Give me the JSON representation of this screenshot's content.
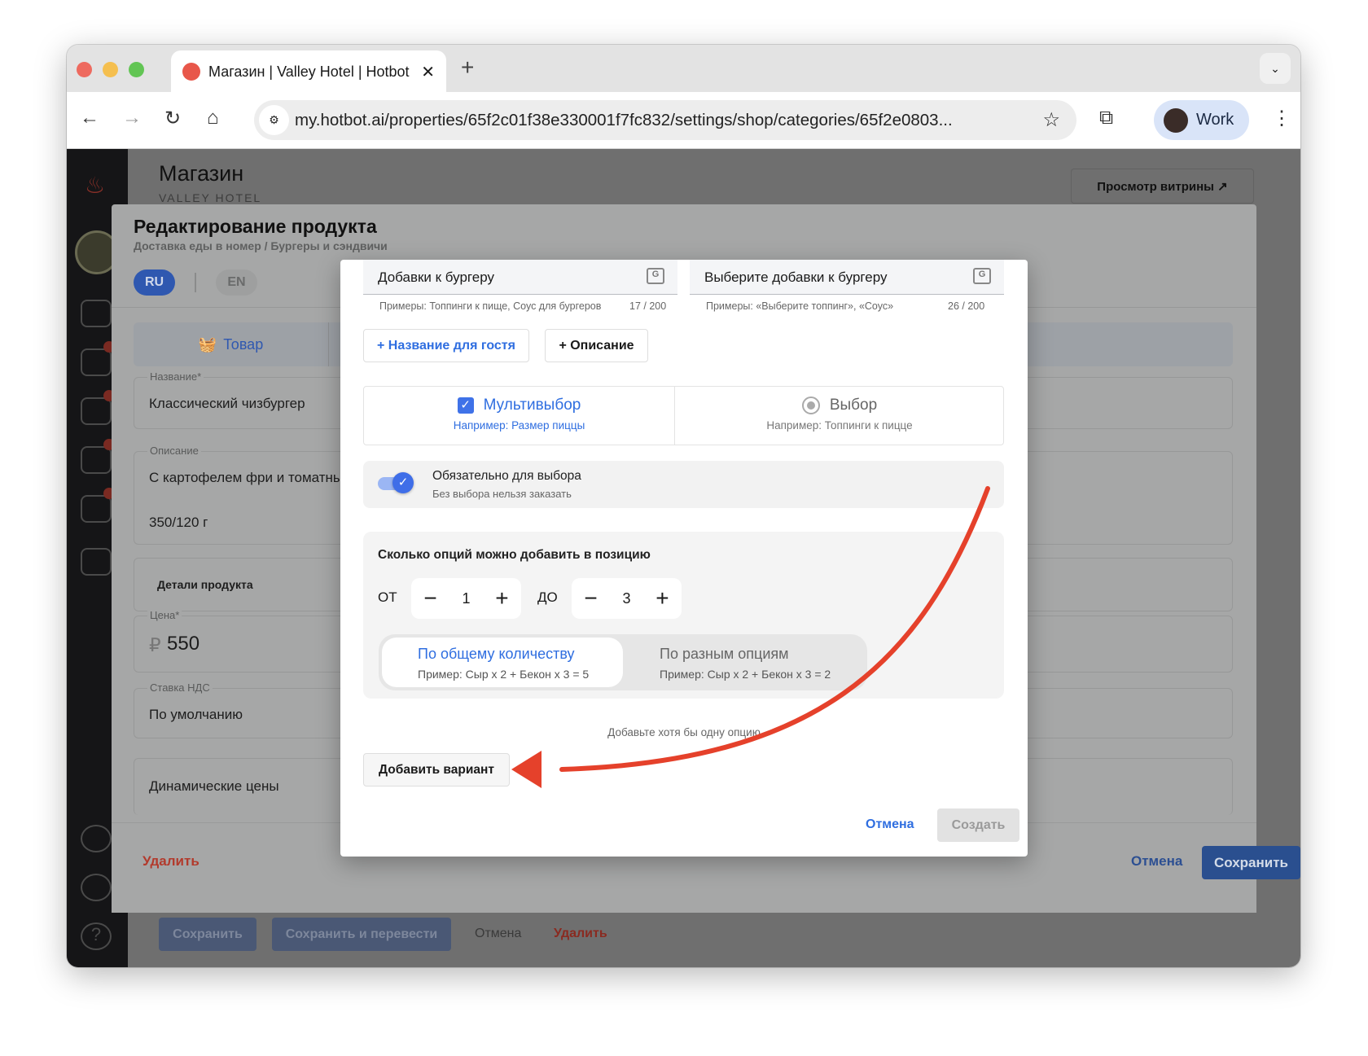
{
  "browser": {
    "tab_title": "Магазин | Valley Hotel | Hotbot",
    "url": "my.hotbot.ai/properties/65f2c01f38e330001f7fc832/settings/shop/categories/65f2e0803...",
    "profile": "Work"
  },
  "page": {
    "title": "Магазин",
    "subtitle": "VALLEY HOTEL",
    "storefront_button": "Просмотр витрины ↗",
    "bottom_bar": {
      "save": "Сохранить",
      "save_translate": "Сохранить и перевести",
      "cancel": "Отмена",
      "delete": "Удалить"
    }
  },
  "product_dialog": {
    "title": "Редактирование продукта",
    "breadcrumb": "Доставка еды в номер / Бургеры и сэндвичи",
    "languages": [
      "RU",
      "EN"
    ],
    "tab": "Товар",
    "fields": {
      "name_label": "Название*",
      "name_value": "Классический чизбургер",
      "desc_label": "Описание",
      "desc_value": "С картофелем фри и томатны",
      "desc_value2": "350/120 г",
      "details": "Детали продукта",
      "price_label": "Цена*",
      "price_currency": "₽",
      "price_value": "550",
      "vat_label": "Ставка НДС",
      "vat_value": "По умолчанию",
      "dynamic": "Динамические цены"
    },
    "delete": "Удалить",
    "cancel": "Отмена",
    "save": "Сохранить"
  },
  "modifier_modal": {
    "name_value": "Добавки к бургеру",
    "name_help": "Примеры: Топпинги к пище, Соус для бургеров",
    "name_count": "17 / 200",
    "title_value": "Выберите добавки к бургеру",
    "title_help": "Примеры: «Выберите топпинг», «Соус»",
    "title_count": "26 / 200",
    "add_guest_name": "+ Название для гостя",
    "add_description": "+ Описание",
    "multi": {
      "label": "Мультивыбор",
      "example": "Например: Размер пиццы",
      "checked": true
    },
    "single": {
      "label": "Выбор",
      "example": "Например: Топпинги к пицце",
      "checked": false
    },
    "required": {
      "label": "Обязательно для выбора",
      "hint": "Без выбора нельзя заказать",
      "on": true
    },
    "range": {
      "title": "Сколько опций можно добавить в позицию",
      "from_label": "ОТ",
      "from_value": "1",
      "to_label": "ДО",
      "to_value": "3",
      "modes": [
        {
          "label": "По общему количеству",
          "example": "Пример: Сыр x 2 + Бекон x 3 = 5",
          "active": true
        },
        {
          "label": "По разным опциям",
          "example": "Пример: Сыр x 2 + Бекон x 3 = 2",
          "active": false
        }
      ]
    },
    "empty_hint": "Добавьте хотя бы одну опцию",
    "add_variant": "Добавить вариант",
    "cancel": "Отмена",
    "create": "Создать"
  },
  "colors": {
    "accent": "#2f6ee0",
    "arrow": "#e5412b",
    "danger": "#c0392b"
  }
}
